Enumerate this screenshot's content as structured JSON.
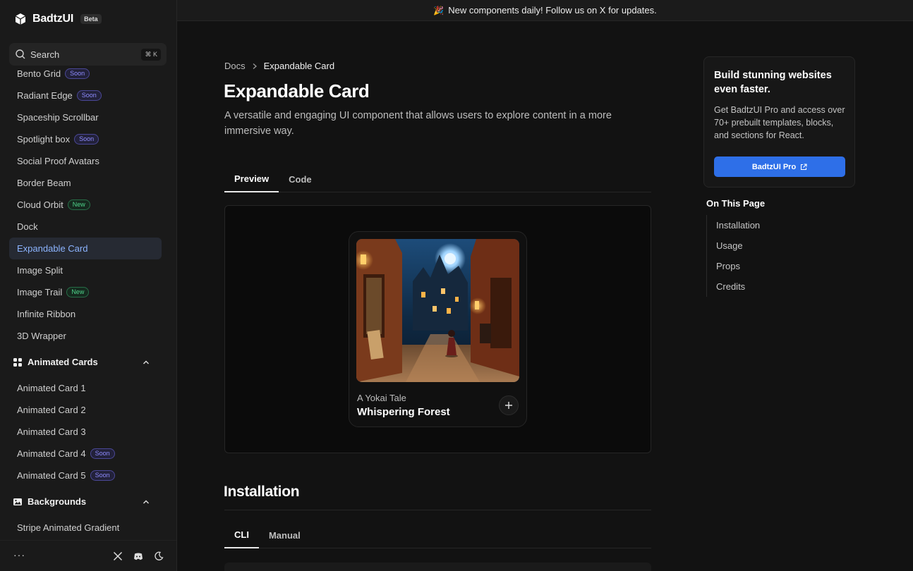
{
  "brand": {
    "name": "BadtzUI",
    "tag": "Beta"
  },
  "search": {
    "placeholder": "Search",
    "shortcut": "⌘ K"
  },
  "sidebar": {
    "items_a": [
      {
        "label": "Bento Grid",
        "badge": "Soon",
        "badge_type": "soon"
      },
      {
        "label": "Radiant Edge",
        "badge": "Soon",
        "badge_type": "soon"
      },
      {
        "label": "Spaceship Scrollbar"
      },
      {
        "label": "Spotlight box",
        "badge": "Soon",
        "badge_type": "soon"
      },
      {
        "label": "Social Proof Avatars"
      },
      {
        "label": "Border Beam"
      },
      {
        "label": "Cloud Orbit",
        "badge": "New",
        "badge_type": "new"
      },
      {
        "label": "Dock"
      },
      {
        "label": "Expandable Card",
        "active": true
      },
      {
        "label": "Image Split"
      },
      {
        "label": "Image Trail",
        "badge": "New",
        "badge_type": "new"
      },
      {
        "label": "Infinite Ribbon"
      },
      {
        "label": "3D Wrapper"
      }
    ],
    "section_cards": {
      "label": "Animated Cards",
      "icon": "grid-icon"
    },
    "items_b": [
      {
        "label": "Animated Card 1"
      },
      {
        "label": "Animated Card 2"
      },
      {
        "label": "Animated Card 3"
      },
      {
        "label": "Animated Card 4",
        "badge": "Soon",
        "badge_type": "soon"
      },
      {
        "label": "Animated Card 5",
        "badge": "Soon",
        "badge_type": "soon"
      }
    ],
    "section_bg": {
      "label": "Backgrounds",
      "icon": "image-icon"
    },
    "items_c": [
      {
        "label": "Stripe Animated Gradient"
      }
    ],
    "footer": {
      "more": "···"
    }
  },
  "banner": {
    "emoji": "🎉",
    "text": "New components daily! Follow us on X for updates."
  },
  "breadcrumb": {
    "root": "Docs",
    "current": "Expandable Card"
  },
  "page": {
    "title": "Expandable Card",
    "description": "A versatile and engaging UI component that allows users to explore content in a more immersive way."
  },
  "tabs": {
    "preview": "Preview",
    "code": "Code"
  },
  "card": {
    "subtitle": "A Yokai Tale",
    "title": "Whispering Forest"
  },
  "installation": {
    "heading": "Installation",
    "tab_cli": "CLI",
    "tab_manual": "Manual"
  },
  "promo": {
    "title": "Build stunning websites even faster.",
    "text": "Get BadtzUI Pro and access over 70+ prebuilt templates, blocks, and sections for React.",
    "button": "BadtzUI Pro"
  },
  "toc": {
    "heading": "On This Page",
    "items": [
      "Installation",
      "Usage",
      "Props",
      "Credits"
    ]
  },
  "colors": {
    "accent": "#2e6fe8",
    "active_nav_text": "#8cb4ff",
    "soon": "#8f8cff",
    "new": "#4fd38a"
  }
}
